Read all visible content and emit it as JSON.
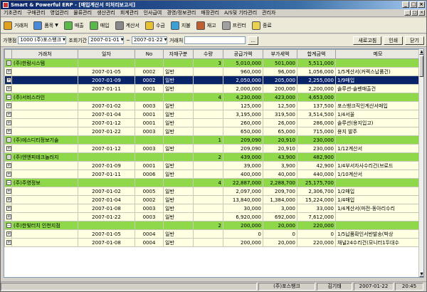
{
  "window": {
    "title": "Smart & Powerful ERP - [매입계산서 미처리보고서]"
  },
  "menu": [
    "기초관리",
    "구매관리",
    "영업관리",
    "물류관리",
    "생산관리",
    "회계관리",
    "인사급여",
    "경영/정보관리",
    "매장관리",
    "A/S및 기타관리",
    "관리자"
  ],
  "toolbar": [
    {
      "label": "거래처",
      "color": "#e0a020",
      "dropdown": false
    },
    {
      "label": "품목",
      "color": "#4a8ad8",
      "dropdown": true
    },
    {
      "label": "매출",
      "color": "#58b848",
      "dropdown": false
    },
    {
      "label": "매입",
      "color": "#58b848",
      "dropdown": false
    },
    {
      "label": "계산서",
      "color": "#888888",
      "dropdown": false
    },
    {
      "label": "수금",
      "color": "#e8c030",
      "dropdown": false
    },
    {
      "label": "지불",
      "color": "#3aa0d8",
      "dropdown": false
    },
    {
      "label": "재고",
      "color": "#c06030",
      "dropdown": false
    },
    {
      "label": "프린터",
      "color": "#a0a0a0",
      "dropdown": false
    },
    {
      "label": "종료",
      "color": "#e8d050",
      "dropdown": false
    }
  ],
  "filter": {
    "store_label": "가맹점",
    "store_value": "1000 (주)포스뱅크",
    "period_label": "조회기간",
    "date_from": "2007-01-01",
    "date_sep": "~",
    "date_to": "2007-01-22",
    "customer_label": "거래처",
    "customer_value": "",
    "browse_label": "...",
    "refresh_label": "새로고침",
    "print_label": "인쇄",
    "close_label": "닫기"
  },
  "grid": {
    "columns": [
      "거래처",
      "일자",
      "No",
      "자재구분",
      "수량",
      "공급가액",
      "부가세액",
      "합계금액",
      "메모"
    ],
    "rows": [
      {
        "type": "grp",
        "name": "(주)한람시스템",
        "date": "",
        "no": "",
        "kind": "",
        "qty": "3",
        "supply": "5,010,000",
        "vat": "501,000",
        "total": "5,511,000",
        "memo": ""
      },
      {
        "type": "det",
        "name": "",
        "date": "2007-01-05",
        "no": "0002",
        "kind": "일반",
        "qty": "",
        "supply": "960,000",
        "vat": "96,000",
        "total": "1,056,000",
        "memo": "1/5계산서(커렉스납품건)"
      },
      {
        "type": "sel",
        "name": "",
        "date": "2007-01-09",
        "no": "0002",
        "kind": "일반",
        "qty": "",
        "supply": "2,050,000",
        "vat": "205,000",
        "total": "2,255,000",
        "memo": "1/9매입"
      },
      {
        "type": "det",
        "name": "",
        "date": "2007-01-11",
        "no": "0001",
        "kind": "일반",
        "qty": "",
        "supply": "2,000,000",
        "vat": "200,000",
        "total": "2,200,000",
        "memo": "솔루션-솔벤매출건"
      },
      {
        "type": "grp",
        "name": "(주)서비스라인",
        "date": "",
        "no": "",
        "kind": "",
        "qty": "4",
        "supply": "4,230,000",
        "vat": "423,000",
        "total": "4,653,000",
        "memo": ""
      },
      {
        "type": "det",
        "name": "",
        "date": "2007-01-02",
        "no": "0003",
        "kind": "일반",
        "qty": "",
        "supply": "125,000",
        "vat": "12,500",
        "total": "137,500",
        "memo": "포스뱅크직인계산서매입"
      },
      {
        "type": "det",
        "name": "",
        "date": "2007-01-04",
        "no": "0001",
        "kind": "일반",
        "qty": "",
        "supply": "3,195,000",
        "vat": "319,500",
        "total": "3,514,500",
        "memo": "1/4서울"
      },
      {
        "type": "det",
        "name": "",
        "date": "2007-01-12",
        "no": "0001",
        "kind": "일반",
        "qty": "",
        "supply": "260,000",
        "vat": "26,000",
        "total": "286,000",
        "memo": "솔루션(용지입고)"
      },
      {
        "type": "det",
        "name": "",
        "date": "2007-01-22",
        "no": "0003",
        "kind": "일반",
        "qty": "",
        "supply": "650,000",
        "vat": "65,000",
        "total": "715,000",
        "memo": "용지 발주"
      },
      {
        "type": "grp",
        "name": "(주)에스디티정보기술",
        "date": "",
        "no": "",
        "kind": "",
        "qty": "1",
        "supply": "209,090",
        "vat": "20,910",
        "total": "230,000",
        "memo": ""
      },
      {
        "type": "det",
        "name": "",
        "date": "2007-01-12",
        "no": "0003",
        "kind": "일반",
        "qty": "",
        "supply": "209,090",
        "vat": "20,910",
        "total": "230,000",
        "memo": "1/12계산서"
      },
      {
        "type": "grp",
        "name": "(주)엔엔피테크놀러지",
        "date": "",
        "no": "",
        "kind": "",
        "qty": "2",
        "supply": "439,000",
        "vat": "43,900",
        "total": "482,900",
        "memo": ""
      },
      {
        "type": "det",
        "name": "",
        "date": "2007-01-09",
        "no": "0001",
        "kind": "일반",
        "qty": "",
        "supply": "39,000",
        "vat": "3,900",
        "total": "42,900",
        "memo": "1/4부서자사수리건(브로드"
      },
      {
        "type": "det",
        "name": "",
        "date": "2007-01-11",
        "no": "0006",
        "kind": "일반",
        "qty": "",
        "supply": "400,000",
        "vat": "40,000",
        "total": "440,000",
        "memo": "1/10계산서"
      },
      {
        "type": "grp",
        "name": "(주)주영정보",
        "date": "",
        "no": "",
        "kind": "",
        "qty": "4",
        "supply": "22,887,000",
        "vat": "2,288,700",
        "total": "25,175,700",
        "memo": ""
      },
      {
        "type": "det",
        "name": "",
        "date": "2007-01-02",
        "no": "0005",
        "kind": "일반",
        "qty": "",
        "supply": "2,097,000",
        "vat": "209,700",
        "total": "2,306,700",
        "memo": "1/2매입"
      },
      {
        "type": "det",
        "name": "",
        "date": "2007-01-04",
        "no": "0002",
        "kind": "일반",
        "qty": "",
        "supply": "13,840,000",
        "vat": "1,384,000",
        "total": "15,224,000",
        "memo": "1/4매입"
      },
      {
        "type": "det",
        "name": "",
        "date": "2007-01-08",
        "no": "0003",
        "kind": "일반",
        "qty": "",
        "supply": "30,000",
        "vat": "3,000",
        "total": "33,000",
        "memo": "1/4계산서(마전-동아리수리"
      },
      {
        "type": "det",
        "name": "",
        "date": "2007-01-22",
        "no": "0003",
        "kind": "일반",
        "qty": "",
        "supply": "6,920,000",
        "vat": "692,000",
        "total": "7,612,000",
        "memo": ""
      },
      {
        "type": "grp",
        "name": "(주)한빛터치 인천지점",
        "date": "",
        "no": "",
        "kind": "",
        "qty": "2",
        "supply": "200,000",
        "vat": "20,000",
        "total": "220,000",
        "memo": ""
      },
      {
        "type": "det",
        "name": "",
        "date": "2007-01-05",
        "no": "0004",
        "kind": "일반",
        "qty": "",
        "supply": "0",
        "vat": "0",
        "total": "0",
        "memo": "1/5납품확인서반발송(박상"
      },
      {
        "type": "det",
        "name": "",
        "date": "2007-01-08",
        "no": "0004",
        "kind": "일반",
        "qty": "",
        "supply": "200,000",
        "vat": "20,000",
        "total": "220,000",
        "memo": "채널24수리건(모니터1두대수"
      }
    ]
  },
  "status": {
    "left": "",
    "company": "(주)포스뱅크",
    "user": "김기태",
    "date": "2007-01-22",
    "time": "20:45"
  }
}
